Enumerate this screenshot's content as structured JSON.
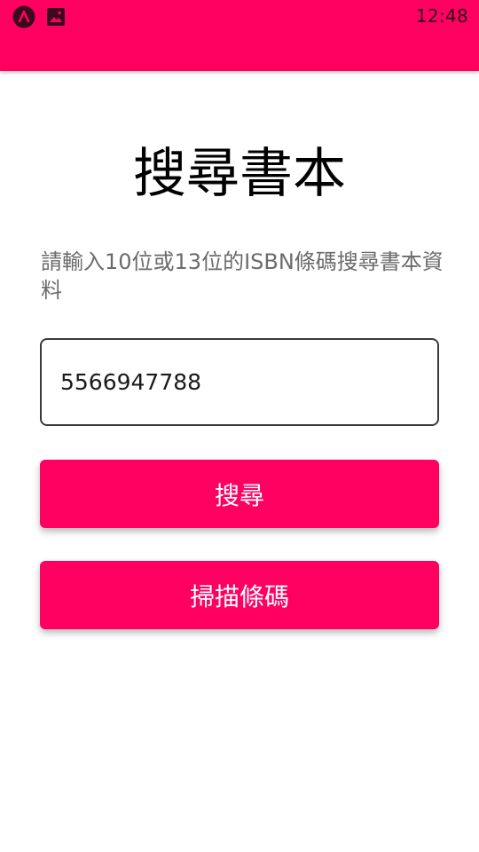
{
  "status_bar": {
    "time": "12:48",
    "icons": [
      "app-notification-icon",
      "image-notification-icon"
    ]
  },
  "app_bar": {
    "color": "#FF0060"
  },
  "main": {
    "title": "搜尋書本",
    "instructions": "請輸入10位或13位的ISBN條碼搜尋書本資料",
    "isbn_input": {
      "value": "5566947788"
    },
    "search_button_label": "搜尋",
    "scan_button_label": "掃描條碼"
  }
}
